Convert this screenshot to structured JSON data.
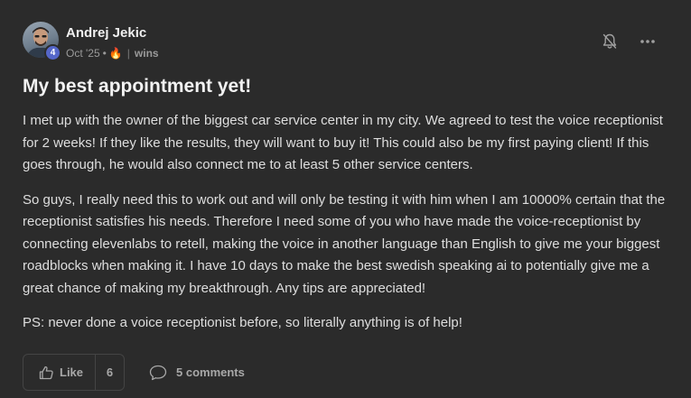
{
  "author": {
    "name": "Andrej Jekic",
    "level": "4",
    "date": "Oct '25",
    "separator": "•",
    "streak_icon": "fire-icon",
    "streak_emoji": "🔥",
    "pipe": "|",
    "category": "wins"
  },
  "actions": {
    "notify_icon": "bell-off-icon",
    "more_icon": "more-horizontal-icon"
  },
  "post": {
    "title": "My best appointment yet!",
    "paragraphs": [
      "I met up with the owner of the biggest car service center in my city. We agreed to test the voice receptionist for 2 weeks! If they like the results, they will want to buy it! This could also be my first paying client! If this goes through, he would also connect me to at least 5 other service centers.",
      "So guys, I really need this to work out and will only be testing it with him when I am 10000% certain that the receptionist satisfies his needs. Therefore I need some of you who have made the voice-receptionist by connecting elevenlabs to retell, making the voice in another language than English to give me your biggest roadblocks when making it. I have 10 days to make the best swedish speaking ai to potentially give me a great chance of making my breakthrough. Any tips are appreciated!",
      "PS: never done a voice receptionist before, so literally anything is of help!"
    ]
  },
  "footer": {
    "like_label": "Like",
    "like_count": "6",
    "comments_label": "5 comments"
  },
  "colors": {
    "background": "#2b2b2b",
    "badge": "#5567c9",
    "text_muted": "#9a9a9a"
  }
}
